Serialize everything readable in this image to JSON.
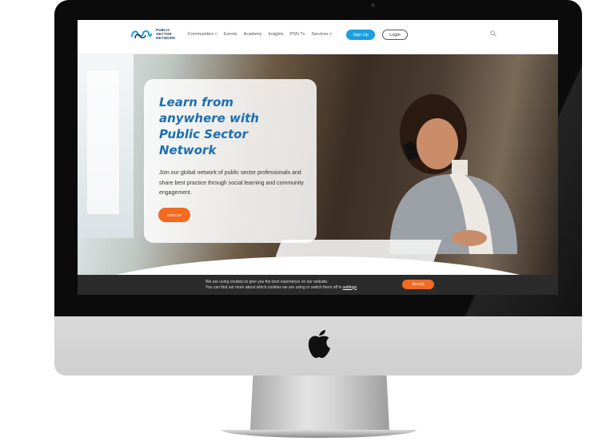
{
  "colors": {
    "brand_blue": "#1a9fe0",
    "title_blue": "#1a6fb0",
    "accent_orange": "#f26b21",
    "cookie_bg": "#2b2b2b"
  },
  "logo": {
    "line1": "PUBLIC",
    "line2": "SECTOR",
    "line3": "NETWORK",
    "icon": "psn-logo-icon"
  },
  "nav": {
    "items": [
      "Communities ˅",
      "Events",
      "Academy",
      "Insights",
      "PSN Tv",
      "Services ˅"
    ],
    "signup_label": "Sign Up",
    "login_label": "Login",
    "search_icon": "search-icon"
  },
  "hero": {
    "title": "Learn from anywhere with Public Sector Network",
    "subtitle": "Join our global network of public sector professionals and share best practice through social learning and community engagement.",
    "cta_label": "SIGN UP"
  },
  "cookie": {
    "line1": "We are using cookies to give you the best experience on our website.",
    "line2": "You can find out more about which cookies we are using or switch them off in",
    "settings_link": "settings",
    "line2_end": ".",
    "accept_label": "Accept"
  },
  "device": {
    "icon": "apple-logo-icon"
  }
}
